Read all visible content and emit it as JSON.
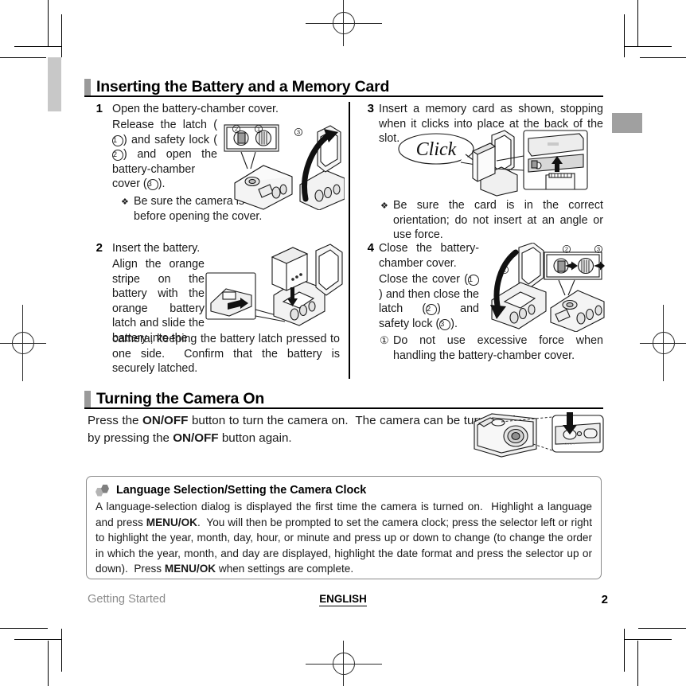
{
  "page": {
    "language_footer": "ENGLISH",
    "footer_left": "Getting Started",
    "page_number": "2"
  },
  "sections": [
    {
      "id": "inserting-battery",
      "title": "Inserting the Battery and a Memory Card",
      "steps": [
        {
          "number": "1",
          "lead": "Open the battery-chamber cover.",
          "body": "Release the latch (①) and safety lock (②) and open the battery-chamber cover (③).",
          "note_glyph": "❖",
          "note": "Be sure the camera is off before opening the cover."
        },
        {
          "number": "2",
          "lead": "Insert the battery.",
          "body": "Align the orange stripe on the battery with the orange battery latch and slide the battery into the camera, keeping the battery latch pressed to one side.  Confirm that the battery is securely latched."
        },
        {
          "number": "3",
          "lead": "Insert a memory card as shown, stopping when it clicks into place at the back of the slot.",
          "callout": "Click",
          "note_glyph": "❖",
          "note": "Be sure the card is in the correct orientation; do not insert at an angle or use force."
        },
        {
          "number": "4",
          "lead": "Close the battery-chamber cover.",
          "body": "Close the cover (①) and then close the latch (②) and safety lock (③).",
          "caution_glyph": "①",
          "caution": "Do not use excessive force when handling the battery-chamber cover."
        }
      ]
    },
    {
      "id": "turning-camera-on",
      "title": "Turning the Camera On",
      "paragraph_parts": [
        {
          "text": "Press the ",
          "bold": false
        },
        {
          "text": "ON/OFF",
          "bold": true
        },
        {
          "text": " button to turn the camera on.  The camera can be turned off by pressing the ",
          "bold": false
        },
        {
          "text": "ON/OFF",
          "bold": true
        },
        {
          "text": " button again.",
          "bold": false
        }
      ]
    }
  ],
  "tip_box": {
    "icon": "two-hexagons-icon",
    "title": "Language Selection/Setting the Camera Clock",
    "parts": [
      {
        "text": "A language-selection dialog is displayed the first time the camera is turned on.  Highlight a language and press ",
        "bold": false
      },
      {
        "text": "MENU/OK",
        "bold": true
      },
      {
        "text": ".  You will then be prompted to set the camera clock; press the selector left or right to highlight the year, month, day, hour, or minute and press up or down to change (to change the order in which the year, month, and day are displayed, highlight the date format and press the selector up or down).  Press ",
        "bold": false
      },
      {
        "text": "MENU/OK",
        "bold": true
      },
      {
        "text": " when settings are complete.",
        "bold": false
      }
    ]
  },
  "illustrations": {
    "step1": {
      "name": "camera-cover-open-diagram",
      "labels": [
        "②",
        "①",
        "③"
      ]
    },
    "step2": {
      "name": "battery-insert-diagram",
      "labels": []
    },
    "step3": {
      "name": "memory-card-insert-diagram",
      "callout": "Click"
    },
    "step4": {
      "name": "camera-cover-close-diagram",
      "labels": [
        "①",
        "②",
        "③"
      ]
    },
    "power": {
      "name": "camera-on-off-button-diagram",
      "labels": []
    }
  },
  "colors": {
    "heading_bar": "#9a9a9a",
    "tab_gray": "#c8c8c8",
    "tab_gray_right": "#a0a0a0",
    "footer_gray": "#8c8c8c",
    "tip_border": "#8a8a8a"
  }
}
